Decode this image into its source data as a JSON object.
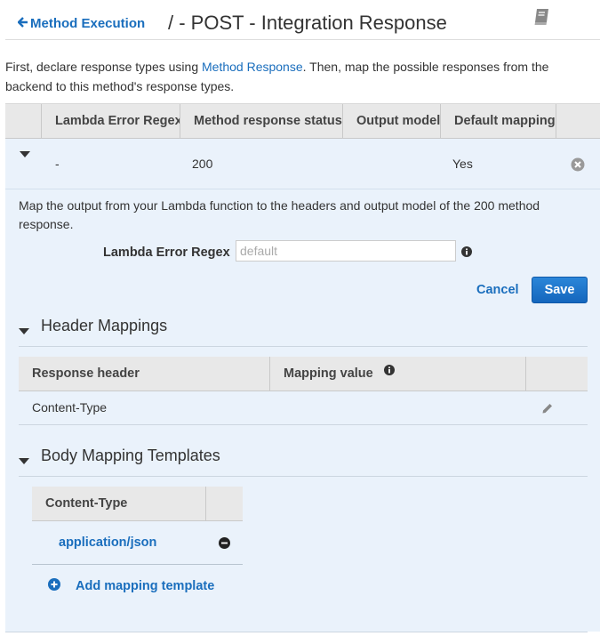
{
  "header": {
    "back_label": "Method Execution",
    "title": "/ - POST - Integration Response"
  },
  "intro": {
    "text_before": "First, declare response types using ",
    "link": "Method Response",
    "text_after": ". Then, map the possible responses from the backend to this method's response types."
  },
  "responses_table": {
    "columns": [
      "Lambda Error Regex",
      "Method response status",
      "Output model",
      "Default mapping"
    ],
    "rows": [
      {
        "regex": "-",
        "status": "200",
        "model": "",
        "default": "Yes"
      }
    ]
  },
  "detail": {
    "description": "Map the output from your Lambda function to the headers and output model of the 200 method response.",
    "regex_label": "Lambda Error Regex",
    "regex_placeholder": "default",
    "regex_value": "",
    "cancel_label": "Cancel",
    "save_label": "Save"
  },
  "header_mappings": {
    "title": "Header Mappings",
    "columns": [
      "Response header",
      "Mapping value"
    ],
    "rows": [
      {
        "header": "Content-Type",
        "value": ""
      }
    ]
  },
  "body_mapping": {
    "title": "Body Mapping Templates",
    "column": "Content-Type",
    "rows": [
      {
        "content_type": "application/json"
      }
    ],
    "add_label": "Add mapping template"
  },
  "colors": {
    "link": "#1a6ebd",
    "panel_bg": "#eaf2fb",
    "save_button": "#1a73cc"
  },
  "icons": {
    "back": "arrow-left-icon",
    "docs": "book-icon",
    "expand": "triangle-down-icon",
    "delete_row": "close-circle-icon",
    "info": "info-circle-icon",
    "edit": "pencil-icon",
    "remove": "minus-circle-icon",
    "add": "plus-circle-icon"
  }
}
